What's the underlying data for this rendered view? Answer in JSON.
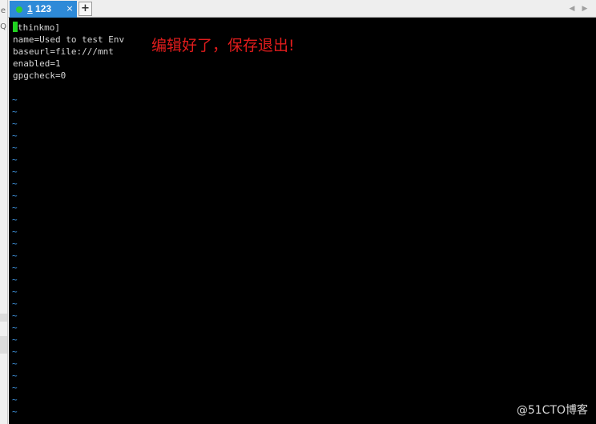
{
  "tab": {
    "number": "1",
    "name": "123",
    "close_glyph": "×",
    "status_color": "#2fd12f"
  },
  "add_tab_label": "+",
  "nav": {
    "prev": "◀",
    "next": "▶"
  },
  "left_strip": {
    "mark1": "e",
    "mark2": "Q"
  },
  "terminal": {
    "cursor_char": "[",
    "lines": [
      "thinkmo]",
      "name=Used to test Env",
      "baseurl=file:///mnt",
      "enabled=1",
      "gpgcheck=0"
    ],
    "empty_line_marker": "~",
    "empty_line_count": 27
  },
  "annotation": "编辑好了，保存退出!",
  "watermark": "@51CTO博客"
}
